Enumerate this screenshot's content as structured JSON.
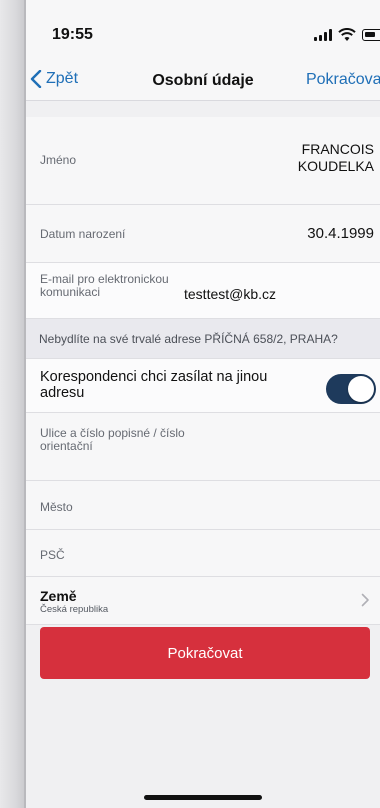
{
  "status_bar": {
    "time": "19:55"
  },
  "nav": {
    "back_label": "Zpět",
    "title": "Osobní údaje",
    "next_label": "Pokračovat"
  },
  "form": {
    "name": {
      "label": "Jméno",
      "value_line1": "FRANCOIS",
      "value_line2": "KOUDELKA"
    },
    "birth_date": {
      "label": "Datum narození",
      "value": "30.4.1999"
    },
    "email": {
      "label": "E-mail pro elektronickou komunikaci",
      "value": "testtest@kb.cz"
    },
    "notice": "Nebydlíte na své trvalé adrese PŘÍČNÁ 658/2, PRAHA?",
    "correspondence": {
      "label": "Korespondenci chci zasílat na jinou adresu",
      "enabled": true,
      "accent": "#1e3a5c"
    },
    "street": {
      "label": "Ulice a číslo popisné / číslo orientační"
    },
    "city": {
      "label": "Město"
    },
    "postal_code": {
      "label": "PSČ"
    },
    "country": {
      "label": "Země",
      "value": "Česká republika"
    }
  },
  "primary_button": {
    "label": "Pokračovat",
    "color": "#d6303d"
  },
  "colors": {
    "link": "#1f6fb7",
    "background": "#f0f0f2"
  },
  "icons": [
    "signal-icon",
    "wifi-icon",
    "battery-icon",
    "back-chevron-icon",
    "chevron-right-icon"
  ]
}
